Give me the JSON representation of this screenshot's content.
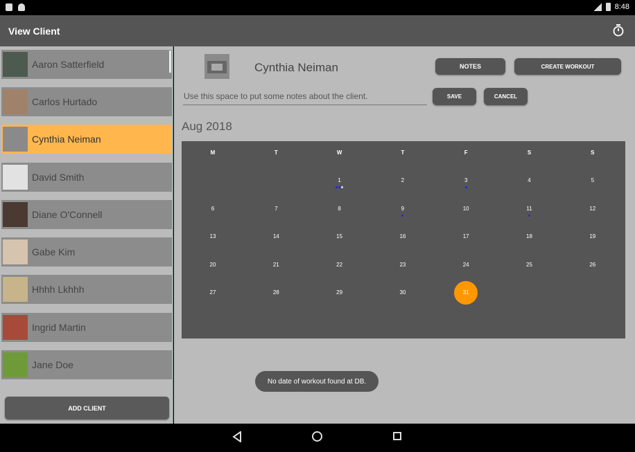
{
  "status_bar": {
    "time": "8:48"
  },
  "app_bar": {
    "title": "View Client"
  },
  "clients": [
    {
      "name": "Aaron Satterfield",
      "thumb_color": "#4d5a4f"
    },
    {
      "name": "Carlos Hurtado",
      "thumb_color": "#a0826a"
    },
    {
      "name": "Cynthia Neiman",
      "thumb_color": "#8a8a8a"
    },
    {
      "name": "David  Smith",
      "thumb_color": "#e2e2e2"
    },
    {
      "name": "Diane O'Connell",
      "thumb_color": "#4a3a32"
    },
    {
      "name": "Gabe Kim",
      "thumb_color": "#d6c4ae"
    },
    {
      "name": "Hhhh Lkhhh",
      "thumb_color": "#c8b48a"
    },
    {
      "name": "Ingrid Martin",
      "thumb_color": "#a84a3a"
    },
    {
      "name": "Jane Doe",
      "thumb_color": "#6e9a3a"
    }
  ],
  "left_panel": {
    "add_client_label": "ADD CLIENT"
  },
  "profile": {
    "name": "Cynthia Neiman",
    "notes_button": "NOTES",
    "create_workout_button": "CREATE WORKOUT",
    "notes_placeholder": "Use this space to put some notes about the client.",
    "save_button": "SAVE",
    "cancel_button": "CANCEL"
  },
  "calendar": {
    "month_title": "Aug 2018",
    "weekdays": [
      "M",
      "T",
      "W",
      "T",
      "F",
      "S",
      "S"
    ],
    "first_day_col": 2,
    "days_in_month": 31,
    "today": 31,
    "workout_dots": {
      "1": 3,
      "3": 1,
      "9": 1,
      "11": 1
    },
    "accent_color": "#ff9800",
    "dot_color": "#2222ee"
  },
  "toast": {
    "message": "No date of workout found at DB."
  }
}
